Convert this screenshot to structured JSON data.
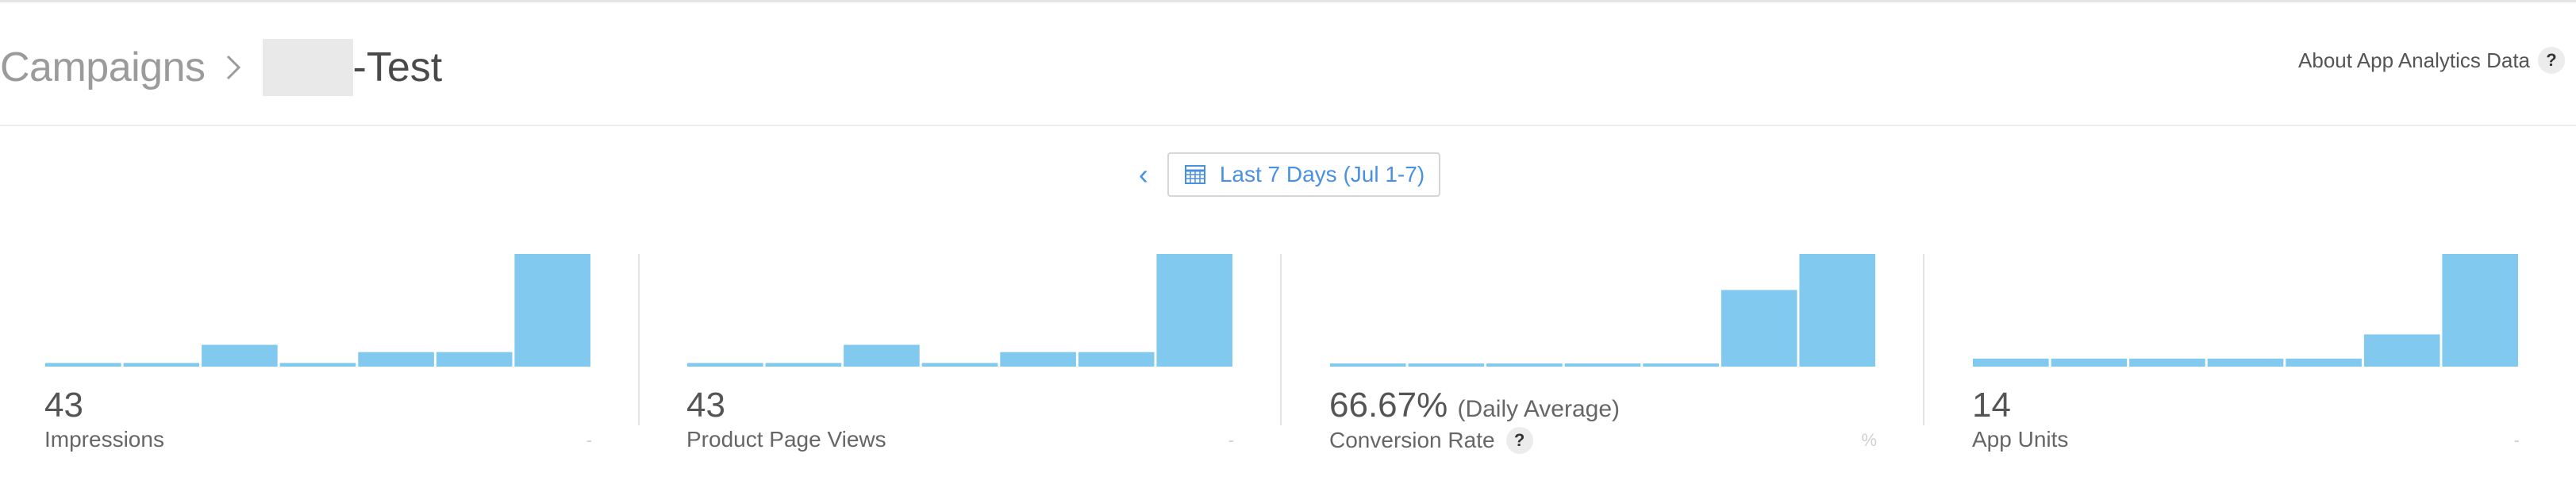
{
  "header": {
    "breadcrumb_parent": "Campaigns",
    "breadcrumb_current": "-Test",
    "about_label": "About App Analytics Data",
    "help_glyph": "?"
  },
  "date_selector": {
    "prev_glyph": "‹",
    "label": "Last 7 Days (Jul 1-7)"
  },
  "colors": {
    "accent": "#4a90e2",
    "bar": "#82c9f0"
  },
  "metrics": [
    {
      "value": "43",
      "suffix": "",
      "label": "Impressions",
      "unit": "-",
      "daily_values": [
        1,
        1,
        6,
        1,
        4,
        4,
        31
      ]
    },
    {
      "value": "43",
      "suffix": "",
      "label": "Product Page Views",
      "unit": "-",
      "daily_values": [
        1,
        1,
        6,
        1,
        4,
        4,
        31
      ]
    },
    {
      "value": "66.67%",
      "suffix": "(Daily Average)",
      "label": "Conversion Rate",
      "unit": "%",
      "help_glyph": "?",
      "daily_values": [
        1,
        1,
        1,
        1,
        1,
        68,
        100
      ]
    },
    {
      "value": "14",
      "suffix": "",
      "label": "App Units",
      "unit": "-",
      "daily_values": [
        1,
        1,
        1,
        1,
        1,
        4,
        14
      ]
    }
  ]
}
